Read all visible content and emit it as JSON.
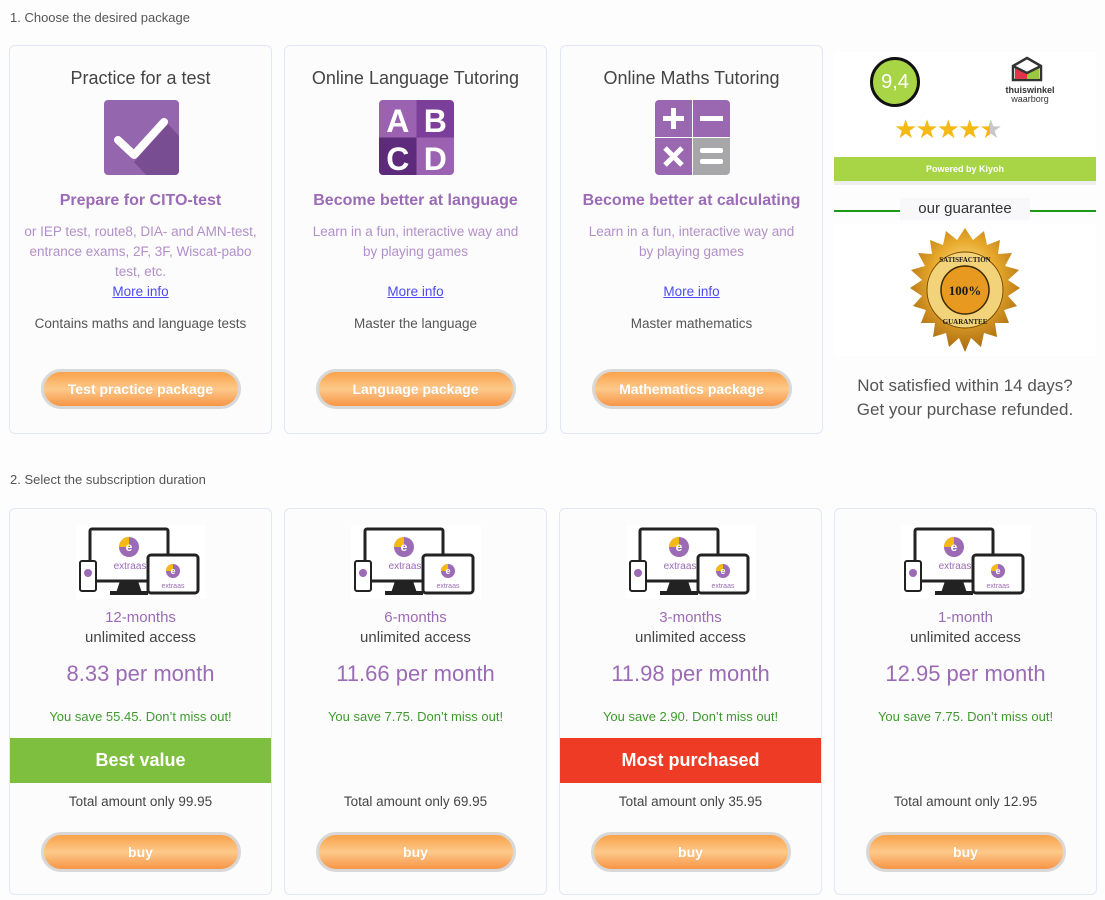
{
  "step1": {
    "title": "1. Choose the desired package"
  },
  "packages": [
    {
      "title": "Practice for a test",
      "icon": "checkmark-icon",
      "subtitle": "Prepare for CITO-test",
      "description": "or IEP test, route8, DIA- and AMN-test, entrance exams, 2F, 3F, Wiscat-pabo test, etc.",
      "more_info": "More info",
      "note": "Contains maths and language tests",
      "button": "Test practice package"
    },
    {
      "title": "Online Language Tutoring",
      "icon": "abcd-icon",
      "subtitle": "Become better at language",
      "description": "Learn in a fun, interactive way and by playing games",
      "more_info": "More info",
      "note": "Master the language",
      "button": "Language package"
    },
    {
      "title": "Online Maths Tutoring",
      "icon": "calculator-icon",
      "subtitle": "Become better at calculating",
      "description": "Learn in a fun, interactive way and by playing games",
      "more_info": "More info",
      "note": "Master mathematics",
      "button": "Mathematics package"
    }
  ],
  "ratings": {
    "score": "9,4",
    "stars": 4.5,
    "shop_line1": "thuiswinkel",
    "shop_line2": "waarborg",
    "powered_by": "Powered by Kiyoh",
    "guarantee_title": "our guarantee",
    "seal_top": "SATISFACTION",
    "seal_center": "100%",
    "seal_bottom": "GUARANTEE",
    "refund_line1": "Not satisfied within 14 days?",
    "refund_line2": "Get your purchase refunded."
  },
  "step2": {
    "title": "2. Select the subscription duration"
  },
  "subscriptions": [
    {
      "duration": "12-months",
      "access": "unlimited access",
      "price": "8.33 per month",
      "save": "You save 55.45. Don’t miss out!",
      "badge": "Best value",
      "badge_color": "#7fbf3f",
      "total": "Total amount only 99.95",
      "button": "buy",
      "logo_text": "extraas"
    },
    {
      "duration": "6-months",
      "access": "unlimited access",
      "price": "11.66 per month",
      "save": "You save 7.75. Don’t miss out!",
      "badge": "",
      "badge_color": "",
      "total": "Total amount only 69.95",
      "button": "buy",
      "logo_text": "extraas"
    },
    {
      "duration": "3-months",
      "access": "unlimited access",
      "price": "11.98 per month",
      "save": "You save 2.90. Don’t miss out!",
      "badge": "Most purchased",
      "badge_color": "#ee3b26",
      "total": "Total amount only 35.95",
      "button": "buy",
      "logo_text": "extraas"
    },
    {
      "duration": "1-month",
      "access": "unlimited access",
      "price": "12.95 per month",
      "save": "You save 7.75. Don’t miss out!",
      "badge": "",
      "badge_color": "",
      "total": "Total amount only 12.95",
      "button": "buy",
      "logo_text": "extraas"
    }
  ],
  "colors": {
    "purple": "#9b6bb5",
    "orange": "#f9a24a",
    "green": "#7fbf3f",
    "red": "#ee3b26",
    "kiyoh_green": "#a8d545"
  }
}
